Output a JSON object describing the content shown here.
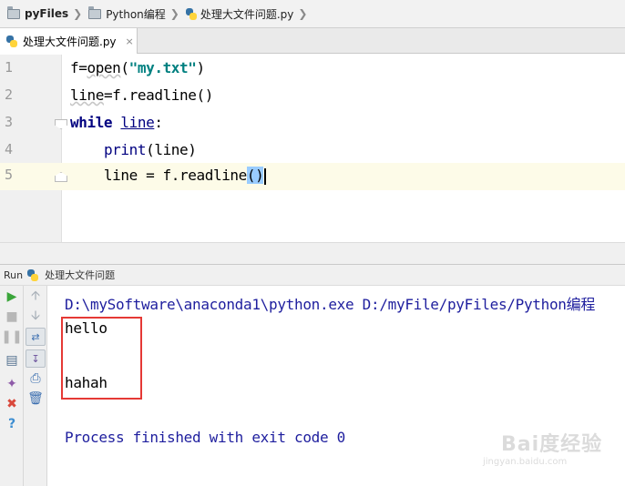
{
  "breadcrumb": {
    "items": [
      {
        "label": "pyFiles",
        "icon": "folder-icon"
      },
      {
        "label": "Python编程",
        "icon": "folder-icon"
      },
      {
        "label": "处理大文件问题.py",
        "icon": "python-file-icon"
      }
    ]
  },
  "editor_tab": {
    "label": "处理大文件问题.py",
    "close": "×"
  },
  "editor": {
    "line_numbers": [
      "1",
      "2",
      "3",
      "4",
      "5"
    ],
    "lines": [
      {
        "t1": "f=",
        "t2": "open",
        "t3": "(",
        "t4": "\"my.txt\"",
        "t5": ")"
      },
      {
        "t1": "line",
        "t2": "=f.readline()"
      },
      {
        "t1": "while",
        "t2": " ",
        "t3": "line",
        "t4": ":"
      },
      {
        "t1": "    ",
        "t2": "print",
        "t3": "(line)"
      },
      {
        "t1": "    line = f.readline",
        "t2": "(",
        "t3": ")"
      }
    ],
    "current_line": 5
  },
  "run_panel": {
    "title": "Run",
    "config_name": "处理大文件问题",
    "console": {
      "command": "D:\\mySoftware\\anaconda1\\python.exe D:/myFile/pyFiles/Python编程",
      "output": [
        "hello",
        "",
        "hahah",
        ""
      ],
      "exit_message": "Process finished with exit code 0"
    }
  },
  "watermark": {
    "text": "Bai度经验",
    "url": "jingyan.baidu.com"
  },
  "colors": {
    "keyword": "#000080",
    "string": "#008080",
    "console_blue": "#1e1e9e",
    "highlight_box": "#e53935"
  }
}
